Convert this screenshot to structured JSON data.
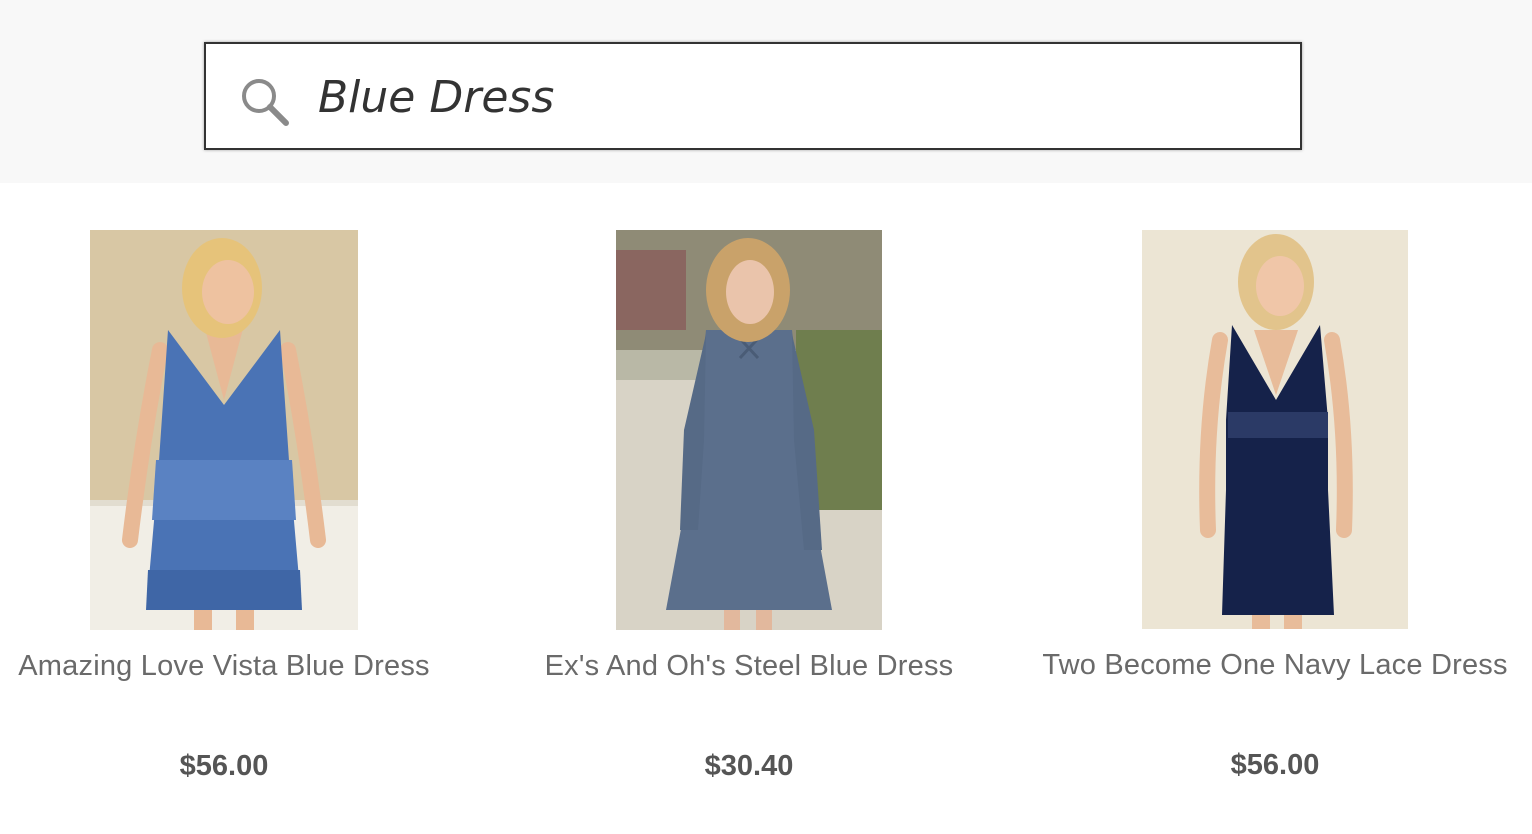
{
  "search": {
    "value": "Blue Dress",
    "icon": "search-icon"
  },
  "products": [
    {
      "name": "Amazing Love Vista Blue Dress",
      "price": "$56.00",
      "dress_color": "#4a73b5",
      "background_color": "#d8c7a4"
    },
    {
      "name": "Ex's And Oh's Steel Blue Dress",
      "price": "$30.40",
      "dress_color": "#5b6f8c",
      "background_color": "#a9a58f"
    },
    {
      "name": "Two Become One Navy Lace Dress",
      "price": "$56.00",
      "dress_color": "#15224a",
      "background_color": "#ece5d4"
    }
  ]
}
